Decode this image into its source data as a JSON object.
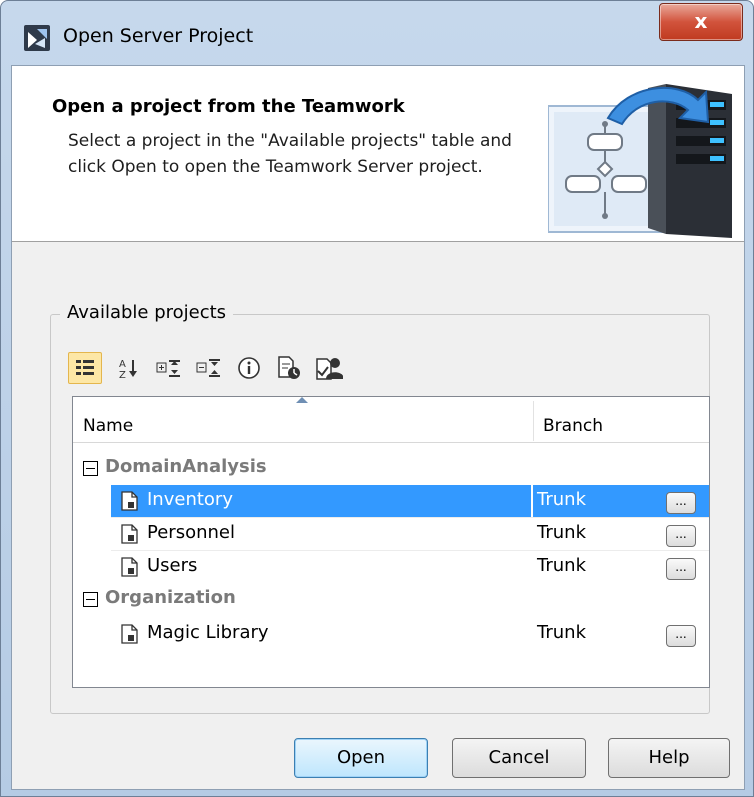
{
  "window": {
    "title": "Open Server Project",
    "close_label": "x"
  },
  "header": {
    "title": "Open a project from the Teamwork",
    "description": "Select a project in the \"Available projects\" table and click Open to open the Teamwork Server project."
  },
  "projects_group": {
    "label": "Available projects",
    "toolbar": [
      {
        "name": "group-by-category-icon",
        "active": true
      },
      {
        "name": "sort-alphabetically-icon",
        "active": false
      },
      {
        "name": "expand-all-icon",
        "active": false
      },
      {
        "name": "collapse-all-icon",
        "active": false
      },
      {
        "name": "info-icon",
        "active": false
      },
      {
        "name": "project-history-icon",
        "active": false
      },
      {
        "name": "project-permissions-icon",
        "active": false
      }
    ]
  },
  "table": {
    "columns": [
      "Name",
      "Branch"
    ],
    "groups": [
      {
        "name": "DomainAnalysis",
        "rows": [
          {
            "name": "Inventory",
            "branch": "Trunk",
            "selected": true
          },
          {
            "name": "Personnel",
            "branch": "Trunk",
            "selected": false
          },
          {
            "name": "Users",
            "branch": "Trunk",
            "selected": false
          }
        ]
      },
      {
        "name": "Organization",
        "rows": [
          {
            "name": "Magic Library",
            "branch": "Trunk",
            "selected": false
          }
        ]
      }
    ],
    "branch_button_label": "..."
  },
  "buttons": {
    "open": "Open",
    "cancel": "Cancel",
    "help": "Help"
  },
  "colors": {
    "selection": "#3399ff",
    "close_button": "#c8452c",
    "titlebar": "#c6d8ec"
  }
}
